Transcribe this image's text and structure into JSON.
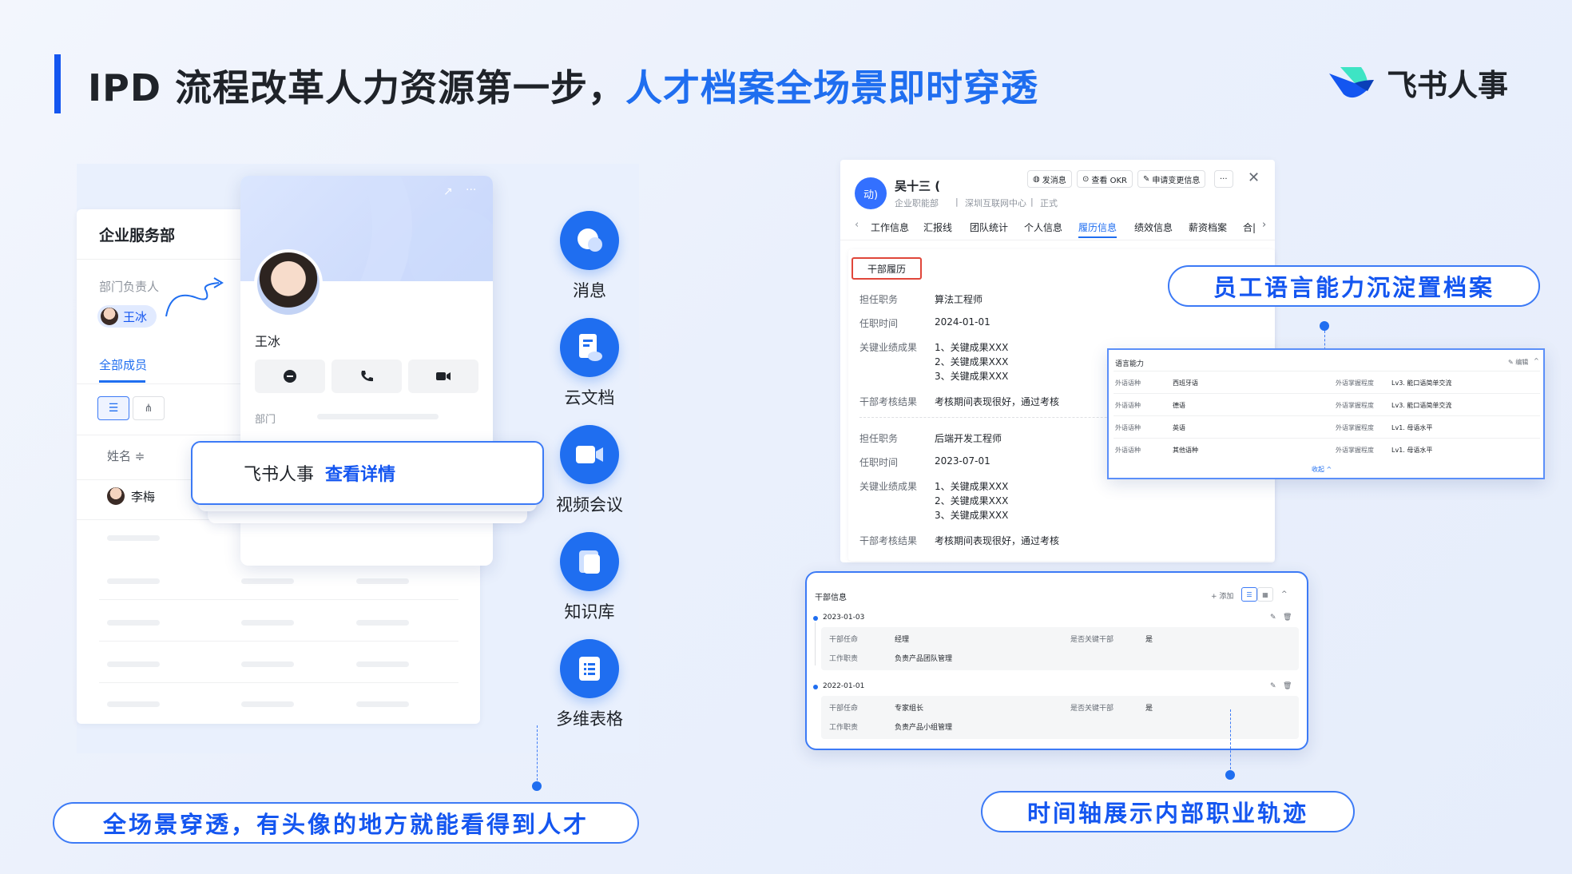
{
  "header": {
    "title_main": "IPD 流程改革人力资源第一步，",
    "title_highlight": "人才档案全场景即时穿透",
    "brand_name": "飞书人事"
  },
  "dept_card": {
    "title": "企业服务部",
    "dept_head_label": "部门负责人",
    "dept_head_name": "王冰",
    "tab_all_members": "全部成员",
    "col_name": "姓名 ≑",
    "member_1": "李梅"
  },
  "profile_card": {
    "name": "王冰",
    "dept_label": "部门"
  },
  "popover": {
    "brand": "飞书人事",
    "link": "查看详情"
  },
  "apps": [
    {
      "label": "消息",
      "icon": "chat-bubble-icon"
    },
    {
      "label": "云文档",
      "icon": "cloud-doc-icon"
    },
    {
      "label": "视频会议",
      "icon": "video-camera-icon"
    },
    {
      "label": "知识库",
      "icon": "knowledge-base-icon"
    },
    {
      "label": "多维表格",
      "icon": "spreadsheet-icon"
    }
  ],
  "callouts": {
    "left": "全场景穿透，有头像的地方就能看得到人才",
    "language": "员工语言能力沉淀置档案",
    "timeline": "时间轴展示内部职业轨迹"
  },
  "employee": {
    "avatar_text": "动)",
    "name": "吴十三 (",
    "org": "企业职能部",
    "center": "深圳互联网中心",
    "status": "正式",
    "btn_message": "发消息",
    "btn_okr": "查看 OKR",
    "btn_change": "申请变更信息",
    "btn_more": "···",
    "tabs": [
      "工作信息",
      "汇报线",
      "团队统计",
      "个人信息",
      "履历信息",
      "绩效信息",
      "薪资档案",
      "合|"
    ],
    "active_tab": "履历信息"
  },
  "resume": {
    "section_title": "干部履历",
    "entries": [
      {
        "position_label": "担任职务",
        "position": "算法工程师",
        "time_label": "任职时间",
        "time": "2024-01-01",
        "perf_label": "关键业绩成果",
        "perf": [
          "1、关键成果XXX",
          "2、关键成果XXX",
          "3、关键成果XXX"
        ],
        "eval_label": "干部考核结果",
        "eval": "考核期间表现很好，通过考核"
      },
      {
        "position_label": "担任职务",
        "position": "后端开发工程师",
        "time_label": "任职时间",
        "time": "2023-07-01",
        "perf_label": "关键业绩成果",
        "perf": [
          "1、关键成果XXX",
          "2、关键成果XXX",
          "3、关键成果XXX"
        ],
        "eval_label": "干部考核结果",
        "eval": "考核期间表现很好，通过考核"
      }
    ]
  },
  "language_card": {
    "title": "语言能力",
    "edit": "✎ 编辑",
    "rows": [
      {
        "type_label": "外语语种",
        "lang": "西班牙语",
        "level_label": "外语掌握程度",
        "level": "Lv3. 能口语简单交流"
      },
      {
        "type_label": "外语语种",
        "lang": "德语",
        "level_label": "外语掌握程度",
        "level": "Lv3. 能口语简单交流"
      },
      {
        "type_label": "外语语种",
        "lang": "英语",
        "level_label": "外语掌握程度",
        "level": "Lv1. 母语水平"
      },
      {
        "type_label": "外语语种",
        "lang": "其他语种",
        "level_label": "外语掌握程度",
        "level": "Lv1. 母语水平"
      }
    ],
    "collapse": "收起 ^"
  },
  "timeline_card": {
    "title": "干部信息",
    "add": "+ 添加",
    "entries": [
      {
        "date": "2023-01-03",
        "role_label": "干部任命",
        "role": "经理",
        "key_label": "是否关键干部",
        "key": "是",
        "duty_label": "工作职责",
        "duty": "负责产品团队管理"
      },
      {
        "date": "2022-01-01",
        "role_label": "干部任命",
        "role": "专家组长",
        "key_label": "是否关键干部",
        "key": "是",
        "duty_label": "工作职责",
        "duty": "负责产品小组管理"
      }
    ]
  },
  "colors": {
    "accent": "#1f6ef0",
    "accent_dark": "#1456f0",
    "highlight_border": "#3c7af6",
    "resume_box": "#e0463a"
  }
}
